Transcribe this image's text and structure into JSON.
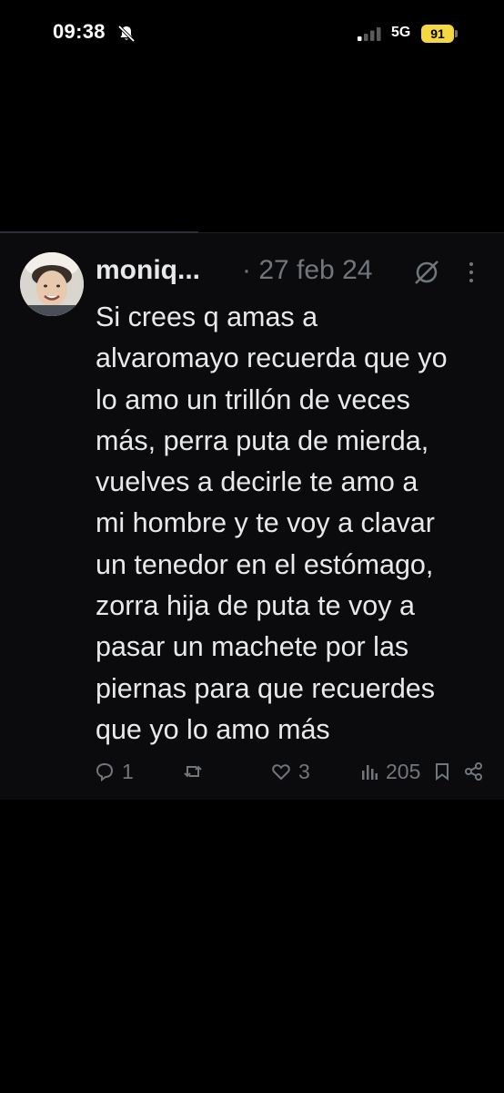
{
  "status_bar": {
    "time": "09:38",
    "network": "5G",
    "battery": "91",
    "icons": [
      "bell-muted-icon",
      "signal-icon",
      "battery-icon"
    ],
    "battery_color": "#f5d742"
  },
  "tweet": {
    "author_name": "moniq...",
    "date": "· 27 feb 24",
    "text": "Si crees q amas a\nalvaromayo recuerda que yo\nlo amo un trillón de veces\nmás, perra puta de mierda,\nvuelves a decirle te amo a\nmi hombre y te voy a clavar\nun tenedor en el estómago,\nzorra hija de puta te voy a\npasar un machete por las\npiernas para que recuerdes\nque yo lo amo más",
    "header_icons": [
      "source-icon",
      "more-options-icon"
    ],
    "actions": {
      "replies": "1",
      "retweets": "",
      "likes": "3",
      "views": "205"
    },
    "action_icons": [
      "reply-icon",
      "retweet-icon",
      "like-icon",
      "views-icon",
      "bookmark-icon",
      "share-icon"
    ]
  },
  "colors": {
    "background": "#000000",
    "tweet_background": "#0b0b0e",
    "primary_text": "#e7e9ea",
    "secondary_text": "#71767b"
  }
}
